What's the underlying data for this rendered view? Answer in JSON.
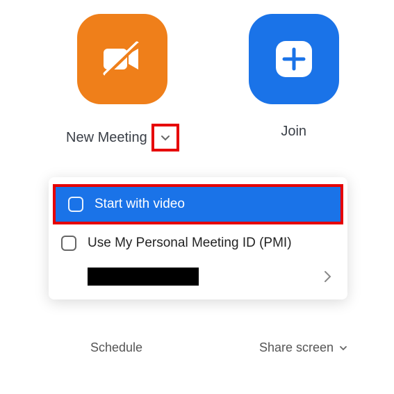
{
  "tiles": {
    "new_meeting": {
      "label": "New Meeting"
    },
    "join": {
      "label": "Join"
    }
  },
  "dropdown": {
    "start_with_video": "Start with video",
    "use_pmi": "Use My Personal Meeting ID (PMI)"
  },
  "bottom": {
    "schedule": "Schedule",
    "share_screen": "Share screen"
  },
  "colors": {
    "orange": "#ef7f1a",
    "blue": "#1a73e8",
    "highlight": "#e60000"
  }
}
